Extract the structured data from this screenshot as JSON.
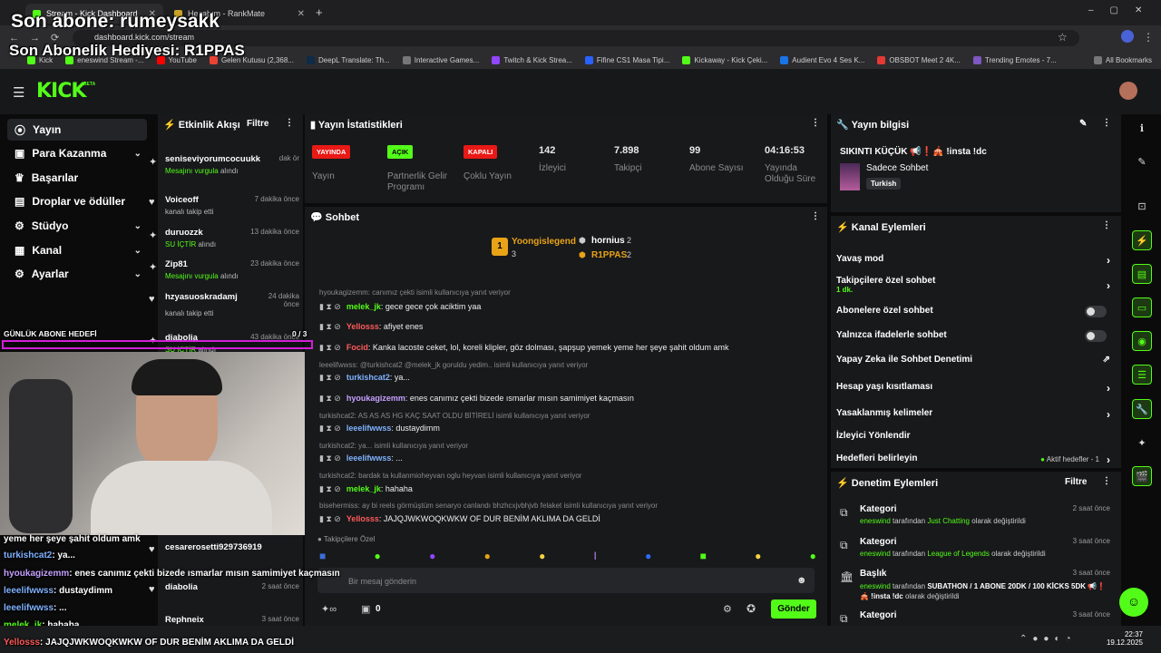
{
  "browser": {
    "tabs": [
      {
        "title": "Stream - Kick Dashboard",
        "active": true
      },
      {
        "title": "Hesabım - RankMate",
        "active": false
      }
    ],
    "url": "dashboard.kick.com/stream",
    "bookmarks": [
      "Kick",
      "eneswind Stream -...",
      "YouTube",
      "Gelen Kutusu (2,368...",
      "DeepL Translate: Th...",
      "Interactive Games...",
      "Twitch & Kick Strea...",
      "Fifine CS1 Masa Tipi...",
      "Kickaway - Kick Çeki...",
      "Audient Evo 4 Ses K...",
      "OBSBOT Meet 2 4K...",
      "Trending Emotes - 7..."
    ],
    "all_bookmarks": "All Bookmarks"
  },
  "overlay": {
    "last_sub": "Son abone: rumeysakk",
    "last_gift": "Son Abonelik Hediyesi: R1PPAS",
    "goal_label": "GÜNLÜK ABONE HEDEFİ",
    "goal_count": "0 / 3",
    "chat": [
      {
        "user": "",
        "text": "yeme her şeye şahit oldum amk",
        "color": "#ffffff"
      },
      {
        "user": "turkishcat2",
        "text": ": ya...",
        "color": "#7fb2ff"
      },
      {
        "user": "hyoukagizemm",
        "text": ": enes canımız çekti bizede ısmarlar mısın samimiyet kaçmasın",
        "color": "#c4a0ff"
      },
      {
        "user": "leeelifwwss",
        "text": ": dustaydimm",
        "color": "#7fb2ff"
      },
      {
        "user": "leeelifwwss",
        "text": ": ...",
        "color": "#7fb2ff"
      },
      {
        "user": "melek_jk",
        "text": ": hahaha",
        "color": "#53fc18"
      },
      {
        "user": "Yellosss",
        "text": ": JAJQJWKWOQKWKW OF DUR BENİM AKLIMA DA GELDİ",
        "color": "#ff5a5a"
      }
    ]
  },
  "app": {
    "logo": "KICK",
    "logo_beta": "BETA",
    "nav": [
      {
        "label": "Yayın",
        "icon": "broadcast-icon",
        "chevron": false,
        "selected": true
      },
      {
        "label": "Para Kazanma",
        "icon": "wallet-icon",
        "chevron": true
      },
      {
        "label": "Başarılar",
        "icon": "trophy-icon",
        "chevron": false
      },
      {
        "label": "Droplar ve ödüller",
        "icon": "gift-icon",
        "chevron": false
      },
      {
        "label": "Stüdyo",
        "icon": "studio-icon",
        "chevron": true
      },
      {
        "label": "Kanal",
        "icon": "channel-icon",
        "chevron": true
      },
      {
        "label": "Ayarlar",
        "icon": "gear-icon",
        "chevron": true
      }
    ],
    "activity": {
      "title": "Etkinlik Akışı",
      "filter": "Filtre",
      "events": [
        {
          "user": "seniseviyorumcocuukk",
          "time": "dak ör",
          "action": "Mesajını vurgula",
          "suffix": "alındı",
          "highlight": true
        },
        {
          "user": "Voiceoff",
          "time": "7 dakika önce",
          "action": "kanalı takip etti",
          "suffix": "",
          "highlight": false
        },
        {
          "user": "duruozzk",
          "time": "13 dakika önce",
          "action": "SU İÇTİR",
          "suffix": "alındı",
          "highlight": true
        },
        {
          "user": "Zip81",
          "time": "23 dakika önce",
          "action": "Mesajını vurgula",
          "suffix": "alındı",
          "highlight": true
        },
        {
          "user": "hzyasuoskradamj",
          "time": "24 dakika önce",
          "action": "kanalı takip etti",
          "suffix": "",
          "highlight": false
        },
        {
          "user": "diabolia",
          "time": "43 dakika önce",
          "action": "SU İÇTİR",
          "suffix": "alındı",
          "highlight": true
        },
        {
          "user": "cesarerosetti929736919",
          "time": "",
          "action": "",
          "suffix": "",
          "highlight": false
        },
        {
          "user": "diabolia",
          "time": "2 saat önce",
          "action": "",
          "suffix": "",
          "highlight": false
        },
        {
          "user": "Rephneix",
          "time": "3 saat önce",
          "action": "",
          "suffix": "",
          "highlight": false
        }
      ]
    },
    "stats": {
      "title": "Yayın İstatistikleri",
      "items": [
        {
          "badge": "YAYINDA",
          "label": "Yayın",
          "badge_color": "#e91916"
        },
        {
          "badge": "AÇIK",
          "label": "Partnerlik Gelir Programı",
          "badge_color": "#53fc18"
        },
        {
          "badge": "KAPALI",
          "label": "Çoklu Yayın",
          "badge_color": "#e91916"
        },
        {
          "value": "142",
          "label": "İzleyici"
        },
        {
          "value": "7.898",
          "label": "Takipçi"
        },
        {
          "value": "99",
          "label": "Abone Sayısı"
        },
        {
          "value": "04:16:53",
          "label": "Yayında Olduğu Süre"
        }
      ]
    },
    "chat": {
      "title": "Sohbet",
      "top_gifters": [
        {
          "name": "Yoongislegend",
          "count": "3",
          "rank": "1"
        },
        {
          "name": "hornius",
          "count": "2",
          "rank": "2"
        },
        {
          "name": "R1PPAS",
          "count": "2",
          "rank": "3"
        }
      ],
      "messages": [
        {
          "reply": "hyoukagizemm: canımız çekti isimli kullanıcıya yanıt veriyor",
          "user": "melek_jk",
          "text": ": gece gece çok aciktim yaa",
          "color": "#53fc18"
        },
        {
          "reply": "",
          "user": "Yellosss",
          "text": ": afiyet enes",
          "color": "#ff5a5a"
        },
        {
          "reply": "",
          "user": "Focid",
          "text": ": Kanka lacoste ceket, lol, koreli klipler, göz dolması, şapşup yemek yeme her şeye şahit oldum amk",
          "color": "#ff5a5a"
        },
        {
          "reply": "leeelifwwss: @turkishcat2 @melek_jk goruldu yedim.. isimli kullanıcıya yanıt veriyor",
          "user": "turkishcat2",
          "text": ": ya...",
          "color": "#7fb2ff"
        },
        {
          "reply": "",
          "user": "hyoukagizemm",
          "text": ": enes canımız çekti bizede ısmarlar mısın samimiyet kaçmasın",
          "color": "#c4a0ff"
        },
        {
          "reply": "turkishcat2: AS AS AS HG KAÇ SAAT OLDU BİTİRELİ isimli kullanıcıya yanıt veriyor",
          "user": "leeelifwwss",
          "text": ": dustaydimm",
          "color": "#7fb2ff"
        },
        {
          "reply": "turkishcat2: ya... isimli kullanıcıya yanıt veriyor",
          "user": "leeelifwwss",
          "text": ": ...",
          "color": "#7fb2ff"
        },
        {
          "reply": "turkishcat2: bardak ta kullanmioheyvan oglu heyvan isimli kullanıcıya yanıt veriyor",
          "user": "melek_jk",
          "text": ": hahaha",
          "color": "#53fc18"
        },
        {
          "reply": "bisehermiss: ay bi reels görmüştüm senaryo canlandı bhzhcxjvbhjvb felaket isimli kullanıcıya yanıt veriyor",
          "user": "Yellosss",
          "text": ": JAJQJWKWOQKWKW OF DUR BENİM AKLIMA DA GELDİ",
          "color": "#ff5a5a"
        }
      ],
      "followers_only": "Takipçilere Özel",
      "input_placeholder": "Bir mesaj gönderin",
      "points": "0",
      "send": "Gönder"
    },
    "stream_info": {
      "title": "Yayın bilgisi",
      "stream_title": "SIKINTI KÜÇÜK 📢❗🎪 !insta !dc",
      "category": "Sadece Sohbet",
      "language": "Turkish"
    },
    "channel_actions": {
      "title": "Kanal Eylemleri",
      "items": [
        {
          "label": "Yavaş mod",
          "type": "arrow",
          "sub": ""
        },
        {
          "label": "Takipçilere özel sohbet",
          "type": "arrow",
          "sub": "1 dk."
        },
        {
          "label": "Abonelere özel sohbet",
          "type": "toggle",
          "sub": ""
        },
        {
          "label": "Yalnızca ifadelerle sohbet",
          "type": "toggle",
          "sub": ""
        },
        {
          "label": "Yapay Zeka ile Sohbet Denetimi",
          "type": "external",
          "sub": ""
        },
        {
          "label": "Hesap yaşı kısıtlaması",
          "type": "arrow",
          "sub": ""
        },
        {
          "label": "Yasaklanmış kelimeler",
          "type": "arrow",
          "sub": ""
        },
        {
          "label": "İzleyici Yönlendir",
          "type": "none",
          "sub": ""
        },
        {
          "label": "Hedefleri belirleyin",
          "type": "arrow",
          "sub": "",
          "extra": "Aktif hedefler - 1"
        }
      ]
    },
    "mod_actions": {
      "title": "Denetim Eylemleri",
      "filter": "Filtre",
      "items": [
        {
          "head": "Kategori",
          "time": "2 saat önce",
          "by": "eneswind",
          "mid": "tarafından",
          "value": "Just Chatting",
          "tail": "olarak değiştirildi"
        },
        {
          "head": "Kategori",
          "time": "3 saat önce",
          "by": "eneswind",
          "mid": "tarafından",
          "value": "League of Legends",
          "tail": "olarak değiştirildi"
        },
        {
          "head": "Başlık",
          "time": "3 saat önce",
          "by": "eneswind",
          "mid": "tarafından",
          "value": "SUBATHON / 1 ABONE 20DK / 100 KİCKS 5DK 📢❗🎪 !insta !dc",
          "tail": "olarak değiştirildi"
        },
        {
          "head": "Kategori",
          "time": "3 saat önce",
          "by": "",
          "mid": "",
          "value": "",
          "tail": ""
        }
      ]
    }
  },
  "taskbar": {
    "time": "22:37",
    "date": "19.12.2025"
  }
}
